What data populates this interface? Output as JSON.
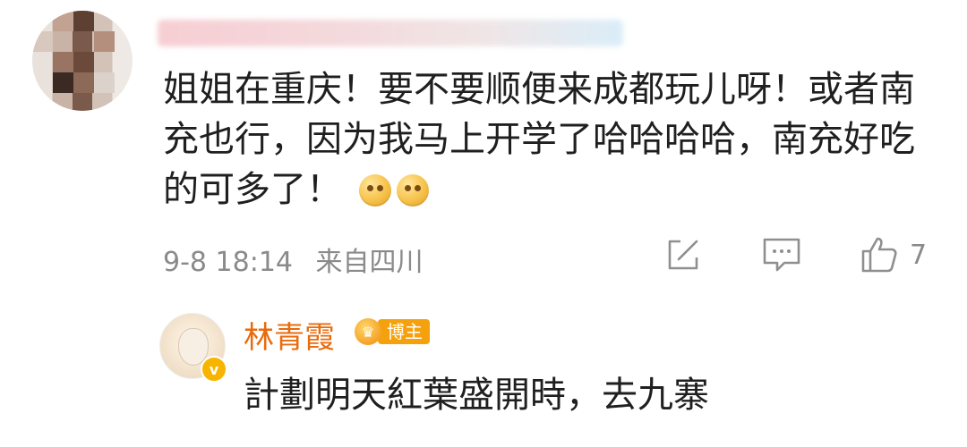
{
  "comment": {
    "author_name": "",
    "text": "姐姐在重庆！要不要顺便来成都玩儿呀！或者南充也行，因为我马上开学了哈哈哈哈，南充好吃的可多了！",
    "emojis": [
      "pleading-emoji",
      "pleading-emoji"
    ],
    "date": "9-8 18:14",
    "location": "来自四川",
    "like_count": "7"
  },
  "reply": {
    "author_name": "林青霞",
    "badge_label": "博主",
    "verified_icon": "v-icon",
    "text": "計劃明天紅葉盛開時，去九寨"
  },
  "icons": {
    "share": "share-icon",
    "comment": "comment-icon",
    "like": "thumbs-up-icon"
  },
  "colors": {
    "reply_name": "#e86b0c",
    "badge": "#f5a10d",
    "meta_text": "#8a8a8a",
    "body_text": "#1f1f1f"
  }
}
